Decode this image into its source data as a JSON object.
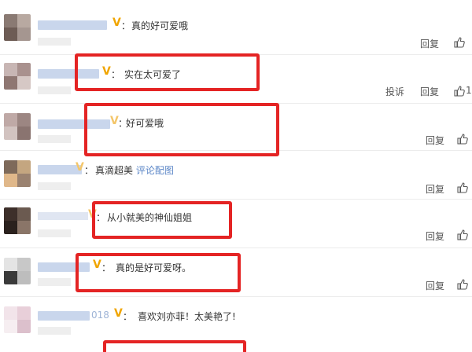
{
  "comments": [
    {
      "author_suffix": "",
      "text": "真的好可爱哦",
      "actions": [
        "回复"
      ],
      "like_count": ""
    },
    {
      "author_suffix": "",
      "text": "实在太可爱了",
      "actions": [
        "投诉",
        "回复"
      ],
      "like_count": "1"
    },
    {
      "author_suffix": "",
      "text": "好可爱哦",
      "actions": [
        "回复"
      ],
      "like_count": ""
    },
    {
      "author_suffix": "",
      "text": "真滴超美",
      "link": "评论配图",
      "actions": [
        "回复"
      ],
      "like_count": ""
    },
    {
      "author_suffix": "",
      "text": "从小就美的神仙姐姐",
      "actions": [
        "回复"
      ],
      "like_count": ""
    },
    {
      "author_suffix": "",
      "text": "真的是好可爱呀。",
      "actions": [
        "回复"
      ],
      "like_count": ""
    },
    {
      "author_suffix": "018",
      "text": "喜欢刘亦菲！太美艳了!",
      "actions": [],
      "like_count": ""
    }
  ],
  "colon": "：",
  "vip_badge": "V",
  "colors": {
    "highlight": "#e42424",
    "link": "#5b86c7",
    "vip": "#f0a500"
  }
}
